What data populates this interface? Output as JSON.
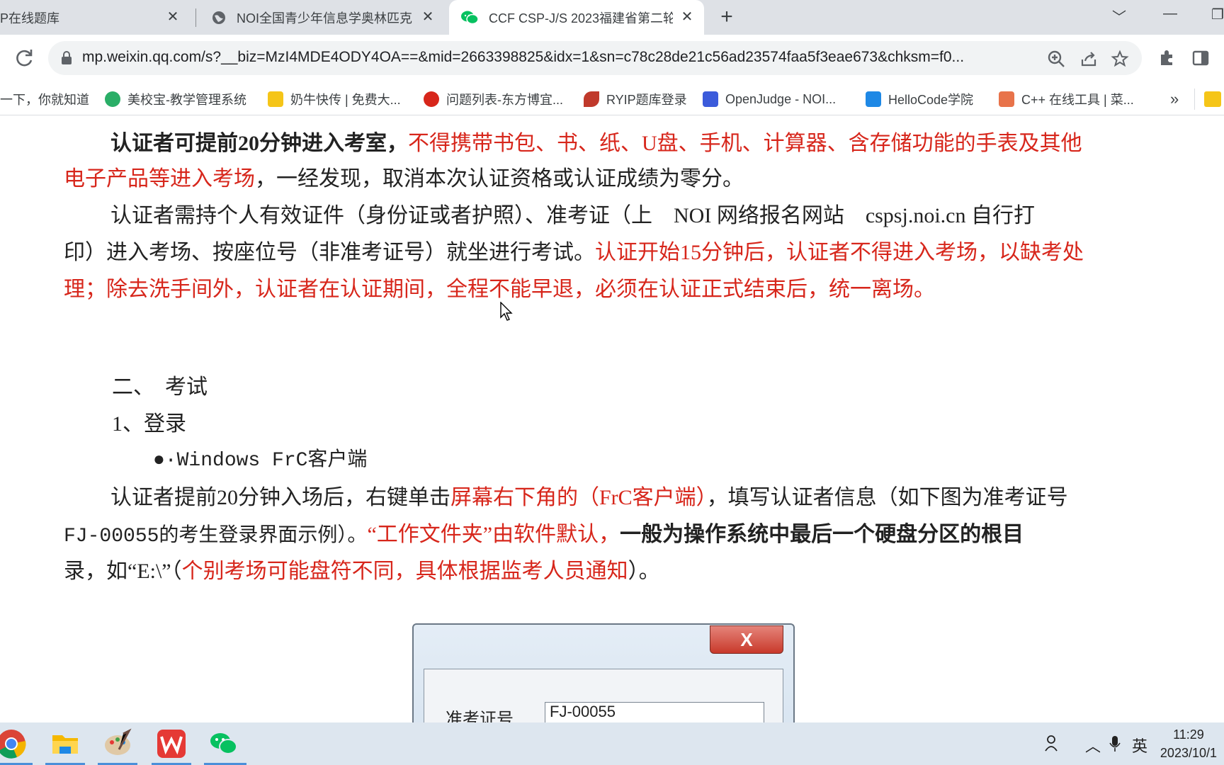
{
  "tabs": [
    {
      "title": "P在线题库",
      "active": false
    },
    {
      "title": "NOI全国青少年信息学奥林匹克",
      "active": false
    },
    {
      "title": "CCF CSP-J/S 2023福建省第二轮",
      "active": true
    }
  ],
  "address": {
    "url": "mp.weixin.qq.com/s?__biz=MzI4MDE4ODY4OA==&mid=2663398825&idx=1&sn=c78c28de21c56ad23574faa5f3eae673&chksm=f0..."
  },
  "bookmarks": [
    {
      "label": "一下，你就知道",
      "icon": "baidu-icon",
      "color": "#2932e1"
    },
    {
      "label": "美校宝-教学管理系统",
      "icon": "wechat-icon",
      "color": "#2aae67"
    },
    {
      "label": "奶牛快传 | 免费大...",
      "icon": "cow-icon",
      "color": "#f5c518"
    },
    {
      "label": "问题列表-东方博宜...",
      "icon": "spiral-icon",
      "color": "#d7261b"
    },
    {
      "label": "RYIP题库登录",
      "icon": "ryip-icon",
      "color": "#c0392b"
    },
    {
      "label": "OpenJudge - NOI...",
      "icon": "poj-icon",
      "color": "#3b5bdb"
    },
    {
      "label": "HelloCode学院",
      "icon": "robot-icon",
      "color": "#1e88e5"
    },
    {
      "label": "C++ 在线工具 | 菜...",
      "icon": "cube-icon",
      "color": "#e8734a"
    }
  ],
  "bookmarks_more": "»",
  "article": {
    "p1_a": "认证者可提前20分钟进入考室，",
    "p1_b": "不得携带书包、书、纸、U盘、手机、计算器、含存储功能的手表及其他",
    "p1_c": "电子产品等进入考场",
    "p1_d": "，一经发现，取消本次认证资格或认证成绩为零分。",
    "p2_a": "认证者需持个人有效证件（身份证或者护照）、准考证（上　NOI 网络报名网站　cspsj.noi.cn 自行打",
    "p2_b": "印）进入考场、按座位号（非准考证号）就坐进行考试。",
    "p2_c": "认证开始15分钟后，认证者不得进入考场，以缺考处",
    "p2_d": "理；除去洗手间外，认证者在认证期间，全程不能早退，必须在认证正式结束后，统一离场。",
    "h2": "二、　考试",
    "h3": "1、登录",
    "bullet": "●·Windows FrC客户端",
    "p3_a": "认证者提前20分钟入场后，右键单击",
    "p3_b": "屏幕右下角的（FrC客户端）",
    "p3_c": "，填写认证者信息（如下图为准考证号",
    "p4_a": "FJ-00055的考生登录界面示例）。",
    "p4_b": "“工作文件夹”由软件默认，",
    "p4_c": "一般为操作系统中最后一个硬盘分区的根目",
    "p5_a": "录，如“E:\\”（",
    "p5_b": "个别考场可能盘符不同，具体根据监考人员通知",
    "p5_c": "）。"
  },
  "dialog": {
    "close_label": "X",
    "field_label": "准考证号",
    "field_value": "FJ-00055"
  },
  "taskbar": {
    "ime": "英",
    "time": "11:29",
    "date": "2023/10/1"
  },
  "colors": {
    "red_text": "#d7261b",
    "tab_strip": "#dee1e6",
    "taskbar": "#dde6ef"
  }
}
